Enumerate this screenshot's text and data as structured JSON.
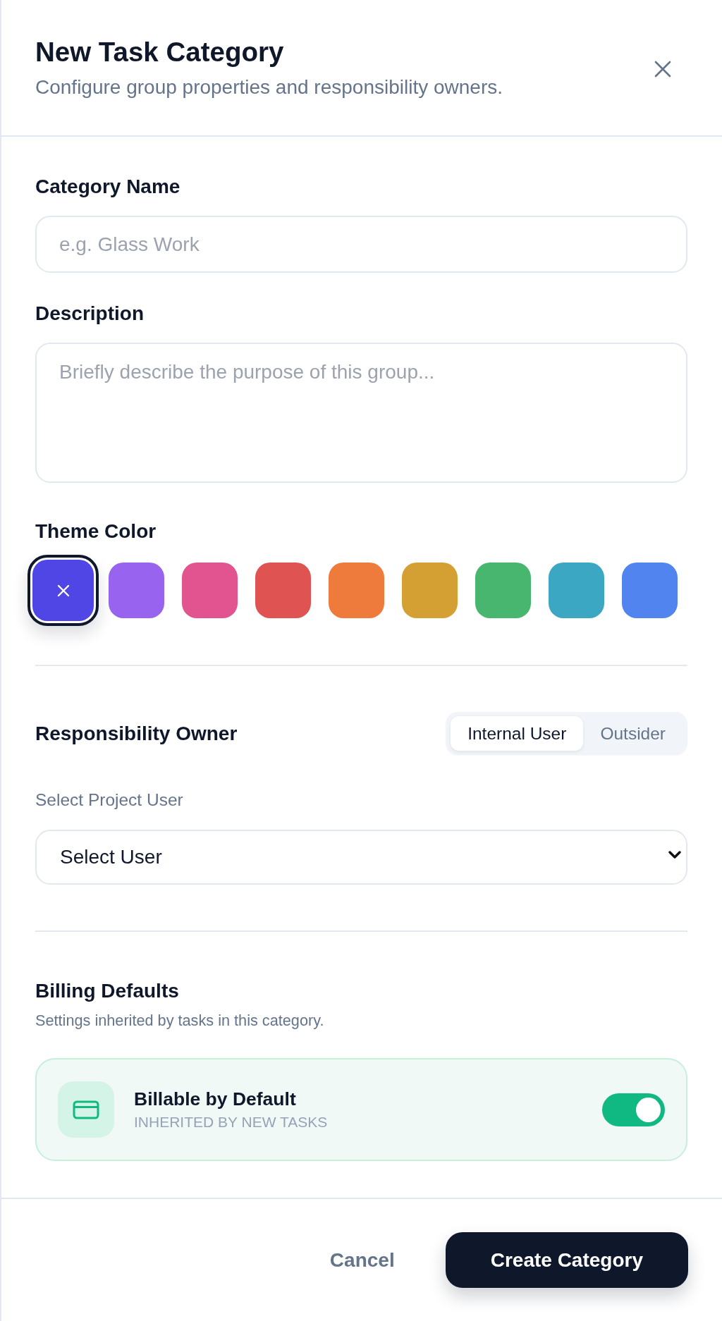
{
  "header": {
    "title": "New Task Category",
    "subtitle": "Configure group properties and responsibility owners."
  },
  "fields": [
    {
      "kind": "text",
      "label": "Category Name",
      "placeholder": "e.g. Glass Work"
    },
    {
      "kind": "textarea",
      "label": "Description",
      "placeholder": "Briefly describe the purpose of this group..."
    }
  ],
  "theme_color": {
    "label": "Theme Color",
    "swatches": [
      {
        "color": "#4f46e5",
        "selected": true
      },
      {
        "color": "#9763ef",
        "selected": false
      },
      {
        "color": "#e2548f",
        "selected": false
      },
      {
        "color": "#e05353",
        "selected": false
      },
      {
        "color": "#ee7a3c",
        "selected": false
      },
      {
        "color": "#d4a034",
        "selected": false
      },
      {
        "color": "#48b66f",
        "selected": false
      },
      {
        "color": "#3ba7c3",
        "selected": false
      },
      {
        "color": "#5284ef",
        "selected": false
      }
    ]
  },
  "responsibility_owner": {
    "label": "Responsibility Owner",
    "tabs": [
      {
        "label": "Internal User",
        "selected": true
      },
      {
        "label": "Outsider",
        "selected": false
      }
    ],
    "select": {
      "label": "Select Project User",
      "value": "Select User"
    }
  },
  "billing_defaults": {
    "title": "Billing Defaults",
    "subtitle": "Settings inherited by tasks in this category.",
    "toggle": {
      "label": "Billable by Default",
      "caption": "INHERITED BY NEW TASKS",
      "on": true
    }
  },
  "footer_buttons": [
    {
      "kind": "secondary",
      "label": "Cancel"
    },
    {
      "kind": "primary",
      "label": "Create Category"
    }
  ]
}
